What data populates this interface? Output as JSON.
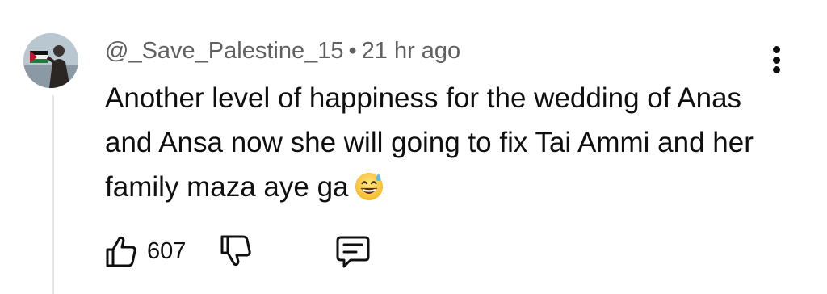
{
  "comment": {
    "author": "@_Save_Palestine_15",
    "separator": "•",
    "time": "21 hr ago",
    "text": "Another level of happiness for the wedding of Anas and Ansa now she will going to fix Tai Ammi and her family maza aye ga",
    "emoji": "grinning-face-with-sweat-icon"
  },
  "actions": {
    "like_count": "607",
    "like_icon": "thumbs-up-icon",
    "dislike_icon": "thumbs-down-icon",
    "reply_icon": "comment-icon",
    "more_icon": "vertical-ellipsis-icon"
  },
  "colors": {
    "text": "#0f0f0f",
    "meta": "#606060",
    "thread_line": "#e5e5e5",
    "background": "#ffffff"
  }
}
